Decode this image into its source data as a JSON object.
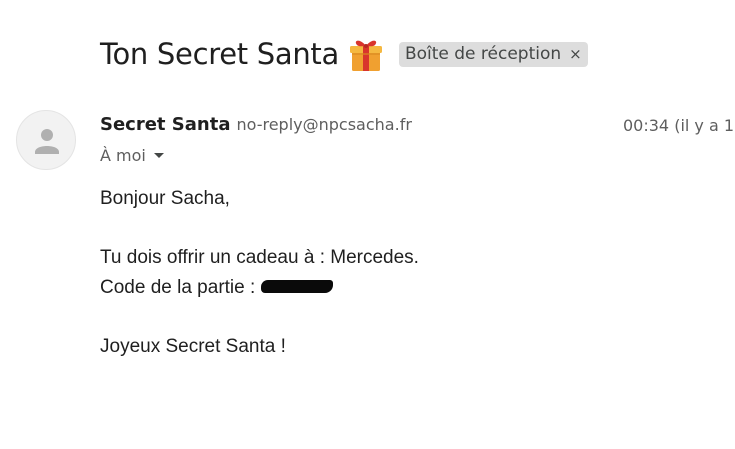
{
  "email": {
    "subject": "Ton Secret Santa",
    "subject_emoji": "gift-icon",
    "label": "Boîte de réception",
    "label_close": "×",
    "sender": {
      "name": "Secret Santa",
      "email": "no-reply@npcsacha.fr"
    },
    "timestamp": "00:34 (il y a 1",
    "recipient": "À moi",
    "body": {
      "greeting": "Bonjour Sacha,",
      "gift_line": "Tu dois offrir un cadeau à : Mercedes.",
      "code_label": "Code de la partie :",
      "closing": "Joyeux Secret Santa !"
    }
  },
  "colors": {
    "chip_bg": "#dddddd",
    "text_primary": "#1f1f1f",
    "text_secondary": "#5e5e5e",
    "avatar_bg": "#f2f2f2",
    "avatar_icon": "#b0b0b0"
  }
}
